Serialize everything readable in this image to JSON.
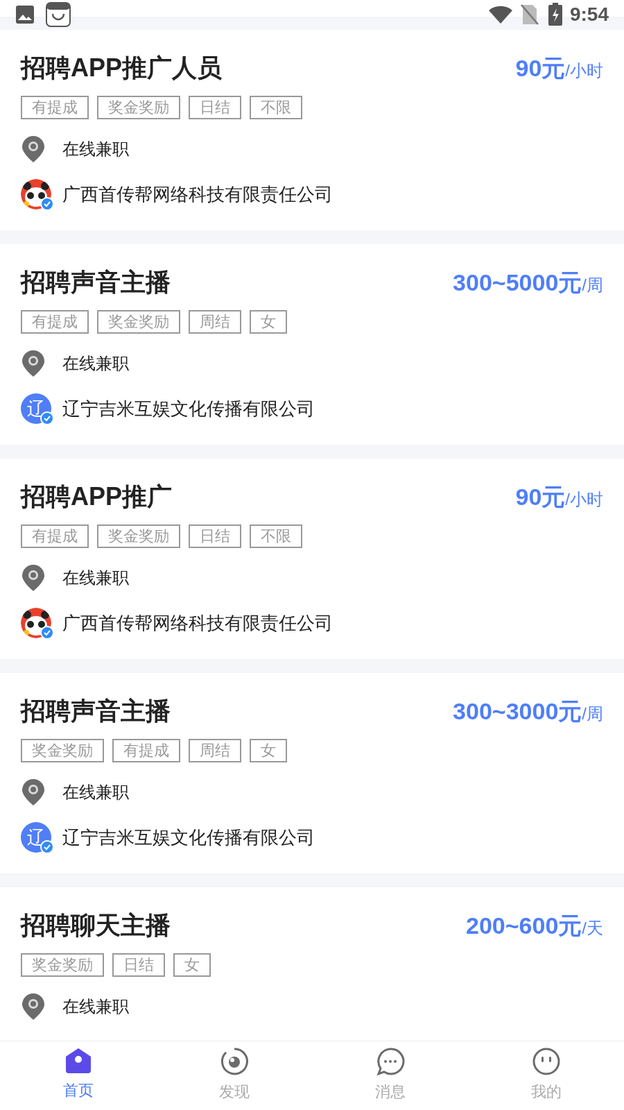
{
  "status_bar": {
    "time": "9:54"
  },
  "jobs": [
    {
      "title": "招聘APP推广人员",
      "pay": "90元",
      "unit": "/小时",
      "tags": [
        "有提成",
        "奖金奖励",
        "日结",
        "不限"
      ],
      "location": "在线兼职",
      "company": {
        "name": "广西首传帮网络科技有限责任公司",
        "kind": "picture",
        "verified": true
      }
    },
    {
      "title": "招聘声音主播",
      "pay": "300~5000元",
      "unit": "/周",
      "tags": [
        "有提成",
        "奖金奖励",
        "周结",
        "女"
      ],
      "location": "在线兼职",
      "company": {
        "name": "辽宁吉米互娱文化传播有限公司",
        "kind": "letter",
        "avatar_text": "辽",
        "verified": true
      }
    },
    {
      "title": "招聘APP推广",
      "pay": "90元",
      "unit": "/小时",
      "tags": [
        "有提成",
        "奖金奖励",
        "日结",
        "不限"
      ],
      "location": "在线兼职",
      "company": {
        "name": "广西首传帮网络科技有限责任公司",
        "kind": "picture",
        "verified": true
      }
    },
    {
      "title": "招聘声音主播",
      "pay": "300~3000元",
      "unit": "/周",
      "tags": [
        "奖金奖励",
        "有提成",
        "周结",
        "女"
      ],
      "location": "在线兼职",
      "company": {
        "name": "辽宁吉米互娱文化传播有限公司",
        "kind": "letter",
        "avatar_text": "辽",
        "verified": true
      }
    },
    {
      "title": "招聘聊天主播",
      "pay": "200~600元",
      "unit": "/天",
      "tags": [
        "奖金奖励",
        "日结",
        "女"
      ],
      "location": "在线兼职"
    }
  ],
  "nav": [
    {
      "label": "首页",
      "kind": "home",
      "selected": true
    },
    {
      "label": "发现",
      "kind": "discover",
      "selected": false
    },
    {
      "label": "消息",
      "kind": "message",
      "selected": false
    },
    {
      "label": "我的",
      "kind": "me",
      "selected": false
    }
  ]
}
